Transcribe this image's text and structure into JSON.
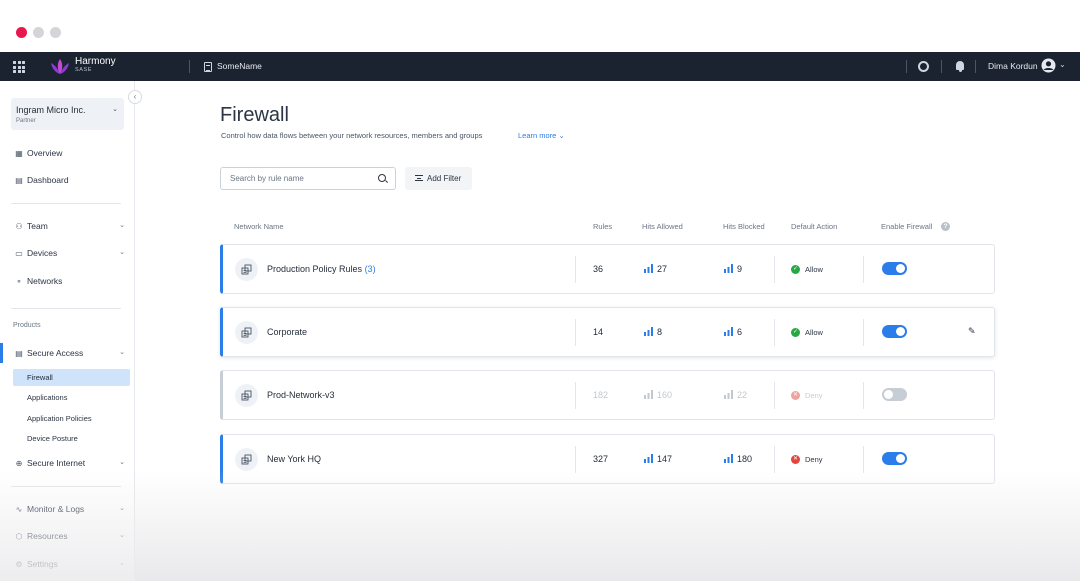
{
  "topbar": {
    "brand_name": "Harmony",
    "brand_sub": "SASE",
    "workspace": "SomeName",
    "user_name": "Dima Kordun"
  },
  "sidebar": {
    "org_name": "Ingram Micro Inc.",
    "org_role": "Partner",
    "nav_top": [
      {
        "label": "Overview"
      },
      {
        "label": "Dashboard"
      }
    ],
    "nav_mid": [
      {
        "label": "Team"
      },
      {
        "label": "Devices"
      },
      {
        "label": "Networks"
      }
    ],
    "products_label": "Products",
    "secure_access": {
      "label": "Secure Access",
      "children": [
        {
          "label": "Firewall"
        },
        {
          "label": "Applications"
        },
        {
          "label": "Application Policies"
        },
        {
          "label": "Device Posture"
        }
      ]
    },
    "secure_internet": {
      "label": "Secure Internet"
    },
    "nav_bottom": [
      {
        "label": "Monitor & Logs"
      },
      {
        "label": "Resources"
      },
      {
        "label": "Settings"
      }
    ]
  },
  "page": {
    "title": "Firewall",
    "subtitle": "Control how data flows between your network resources, members and groups",
    "learn_more": "Learn more",
    "search_placeholder": "Search by rule name",
    "add_filter": "Add Filter"
  },
  "table": {
    "headers": {
      "network_name": "Network Name",
      "rules": "Rules",
      "hits_allowed": "Hits Allowed",
      "hits_blocked": "Hits Blocked",
      "default_action": "Default Action",
      "enable_firewall": "Enable Firewall"
    },
    "rows": [
      {
        "name": "Production Policy Rules",
        "count": "(3)",
        "rules": "36",
        "allowed": "27",
        "blocked": "9",
        "action": "Allow",
        "enabled": true
      },
      {
        "name": "Corporate",
        "count": "",
        "rules": "14",
        "allowed": "8",
        "blocked": "6",
        "action": "Allow",
        "enabled": true
      },
      {
        "name": "Prod-Network-v3",
        "count": "",
        "rules": "182",
        "allowed": "160",
        "blocked": "22",
        "action": "Deny",
        "enabled": false
      },
      {
        "name": "New York HQ",
        "count": "",
        "rules": "327",
        "allowed": "147",
        "blocked": "180",
        "action": "Deny",
        "enabled": true
      }
    ]
  },
  "colors": {
    "accent": "#2b7de9",
    "topbar": "#1b2330",
    "allow": "#28a745",
    "deny": "#e2453d"
  },
  "icons": {
    "apps": "grid-icon",
    "logo": "lotus-logo",
    "help": "help-ring-icon",
    "bell": "bell-icon",
    "avatar": "user-avatar-icon"
  }
}
